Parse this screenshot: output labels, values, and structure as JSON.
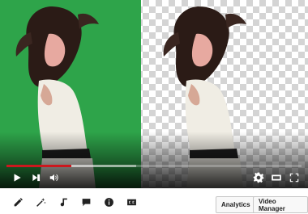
{
  "player": {
    "progress_fraction": 0.22,
    "buffer_fraction": 0.44,
    "controls": {
      "play_icon": "play-icon",
      "next_icon": "next-icon",
      "volume_icon": "volume-icon",
      "settings_icon": "gear-icon",
      "theater_icon": "theater-mode-icon",
      "fullscreen_icon": "fullscreen-icon"
    },
    "colors": {
      "green_screen": "#2ea44a",
      "progress": "#cc181e"
    }
  },
  "toolbar": {
    "tools": [
      {
        "name": "pencil-icon"
      },
      {
        "name": "magic-wand-icon"
      },
      {
        "name": "music-note-icon"
      },
      {
        "name": "speech-bubble-icon"
      },
      {
        "name": "info-icon"
      },
      {
        "name": "cc-icon"
      }
    ],
    "analytics_label": "Analytics",
    "video_manager_label": "Video Manager"
  }
}
